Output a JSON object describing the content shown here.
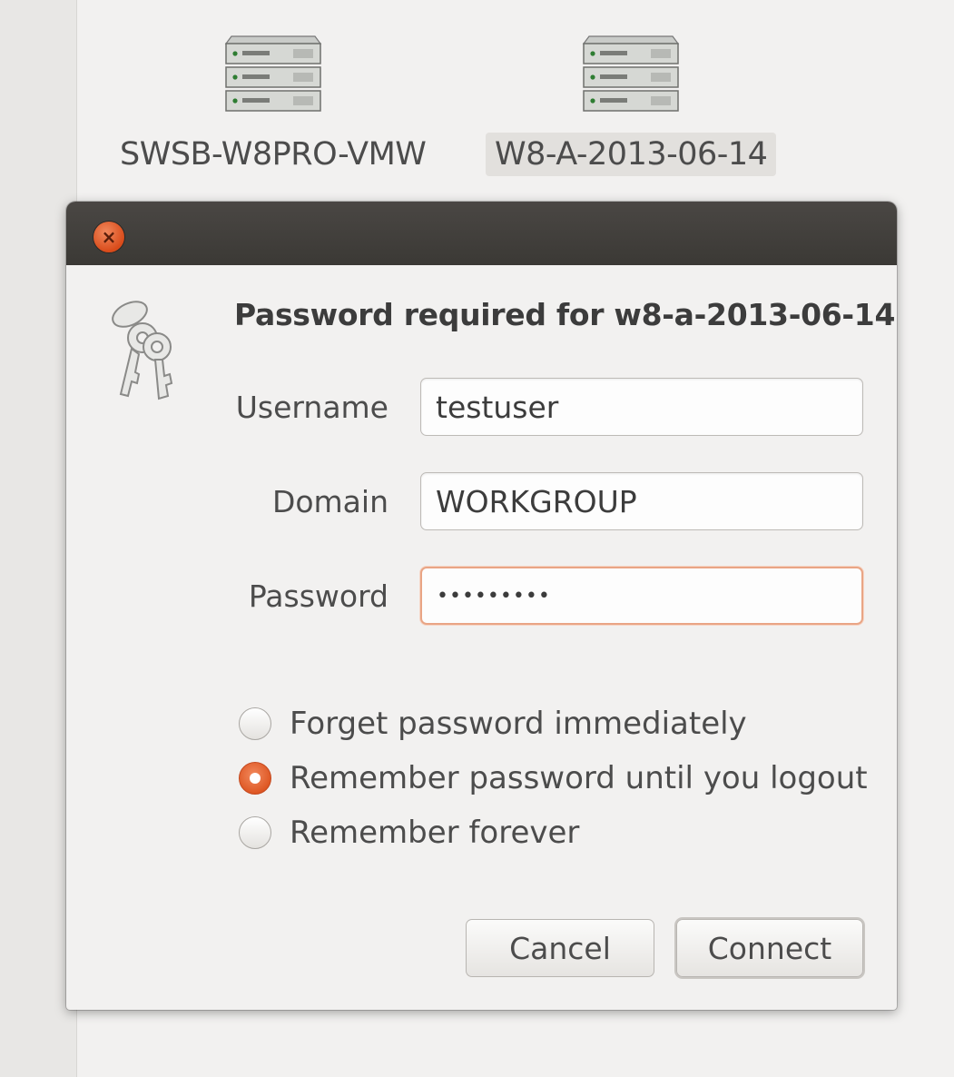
{
  "desktop": {
    "icons": [
      {
        "label": "SWSB-W8PRO-VMW",
        "icon": "server-icon",
        "selected": false
      },
      {
        "label": "W8-A-2013-06-14",
        "icon": "server-icon",
        "selected": true
      }
    ]
  },
  "dialog": {
    "title": "Password required for w8-a-2013-06-14",
    "icon": "keys-icon",
    "close_icon": "close-icon",
    "fields": {
      "username": {
        "label": "Username",
        "value": "testuser"
      },
      "domain": {
        "label": "Domain",
        "value": "WORKGROUP"
      },
      "password": {
        "label": "Password",
        "value": "•••••••••"
      }
    },
    "options": [
      {
        "label": "Forget password immediately",
        "checked": false
      },
      {
        "label": "Remember password until you logout",
        "checked": true
      },
      {
        "label": "Remember forever",
        "checked": false
      }
    ],
    "buttons": {
      "cancel": "Cancel",
      "connect": "Connect"
    }
  },
  "colors": {
    "accent": "#dd5420",
    "titlebar": "#3b3935",
    "background": "#f2f1f0"
  }
}
